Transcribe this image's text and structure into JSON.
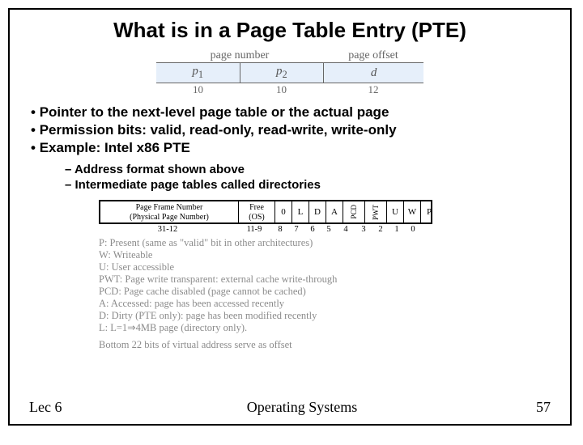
{
  "title": "What is in a Page Table Entry (PTE)",
  "addr": {
    "header_pn": "page number",
    "header_po": "page offset",
    "p1": "p",
    "p1s": "1",
    "p2": "p",
    "p2s": "2",
    "d": "d",
    "w1": "10",
    "w2": "10",
    "w3": "12"
  },
  "bullets": {
    "b1": "Pointer to the next-level page table or the actual page",
    "b2": "Permission bits: valid, read-only, read-write, write-only",
    "b3": "Example: Intel x86 PTE"
  },
  "sub": {
    "s1": "Address format shown above",
    "s2": "Intermediate page tables called directories"
  },
  "pte": {
    "pfn_l1": "Page Frame Number",
    "pfn_l2": "(Physical Page Number)",
    "free_l1": "Free",
    "free_l2": "(OS)",
    "bits": {
      "b0": "0",
      "bL": "L",
      "bD": "D",
      "bA": "A",
      "bPCD": "PCD",
      "bPWT": "PWT",
      "bU": "U",
      "bW": "W",
      "bP": "P"
    },
    "range_main": "31-12",
    "range_free": "11-9",
    "rn8": "8",
    "rn7": "7",
    "rn6": "6",
    "rn5": "5",
    "rn4": "4",
    "rn3": "3",
    "rn2": "2",
    "rn1": "1",
    "rn0": "0"
  },
  "legend": {
    "l1": "P: Present (same as \"valid\" bit in other architectures)",
    "l2": "W: Writeable",
    "l3": "U: User accessible",
    "l4": "PWT: Page write transparent: external cache write-through",
    "l5": "PCD: Page cache disabled (page cannot be cached)",
    "l6": "A: Accessed: page has been accessed recently",
    "l7": "D: Dirty (PTE only): page has been modified recently",
    "l8": "L: L=1⇒4MB page (directory only).",
    "bottom": "Bottom 22 bits of virtual address serve as offset"
  },
  "footer": {
    "left": "Lec 6",
    "center": "Operating Systems",
    "right": "57"
  }
}
